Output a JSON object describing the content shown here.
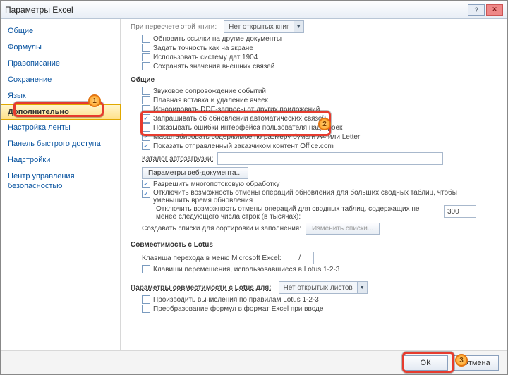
{
  "window": {
    "title": "Параметры Excel"
  },
  "sidebar": {
    "items": [
      {
        "label": "Общие"
      },
      {
        "label": "Формулы"
      },
      {
        "label": "Правописание"
      },
      {
        "label": "Сохранение"
      },
      {
        "label": "Язык"
      },
      {
        "label": "Дополнительно"
      },
      {
        "label": "Настройка ленты"
      },
      {
        "label": "Панель быстрого доступа"
      },
      {
        "label": "Надстройки"
      },
      {
        "label": "Центр управления безопасностью"
      }
    ]
  },
  "truncated_header": {
    "label": "При пересчете этой книги:",
    "dropdown": "Нет открытых книг"
  },
  "recalc": {
    "items": [
      {
        "label": "Обновить ссылки на другие документы"
      },
      {
        "label": "Задать точность как на экране"
      },
      {
        "label": "Использовать систему дат 1904"
      },
      {
        "label": "Сохранять значения внешних связей"
      }
    ]
  },
  "general": {
    "header": "Общие",
    "items": [
      {
        "label": "Звуковое сопровождение событий",
        "checked": false
      },
      {
        "label": "Плавная вставка и удаление ячеек",
        "checked": false
      },
      {
        "label": "Игнорировать DDE-запросы от других приложений",
        "checked": false
      },
      {
        "label": "Запрашивать об обновлении автоматических связей",
        "checked": true
      },
      {
        "label": "Показывать ошибки интерфейса пользователя надстроек",
        "checked": false
      },
      {
        "label": "Масштабировать содержимое по размеру бумаги A4 или Letter",
        "checked": true
      },
      {
        "label": "Показать отправленный заказчиком контент Office.com",
        "checked": true
      }
    ],
    "startup_label": "Каталог автозагрузки:",
    "startup_value": "",
    "webopts_btn": "Параметры веб-документа...",
    "multithread": {
      "label": "Разрешить многопотоковую обработку",
      "checked": true
    },
    "disable_undo": {
      "label": "Отключить возможность отмены операций обновления для больших сводных таблиц, чтобы уменьшить время обновления",
      "checked": true
    },
    "disable_undo_rows": {
      "label": "Отключить возможность отмены операций для сводных таблиц, содержащих не менее следующего числа строк (в тысячах):",
      "value": "300"
    },
    "create_lists": {
      "label": "Создавать списки для сортировки и заполнения:",
      "button": "Изменить списки..."
    }
  },
  "lotus": {
    "header": "Совместимость с Lotus",
    "trans_label": "Клавиша перехода в меню Microsoft Excel:",
    "trans_value": "/",
    "nav": {
      "label": "Клавиши перемещения, использовавшиеся в Lotus 1-2-3",
      "checked": false
    }
  },
  "lotus_for": {
    "label": "Параметры совместимости с Lotus для:",
    "dropdown": "Нет открытых листов",
    "calc": {
      "label": "Производить вычисления по правилам Lotus 1-2-3",
      "checked": false
    },
    "conv": {
      "label": "Преобразование формул в формат Excel при вводе",
      "checked": false
    }
  },
  "buttons": {
    "ok": "ОК",
    "cancel": "Отмена"
  },
  "badges": {
    "b1": "1",
    "b2": "2",
    "b3": "3"
  }
}
